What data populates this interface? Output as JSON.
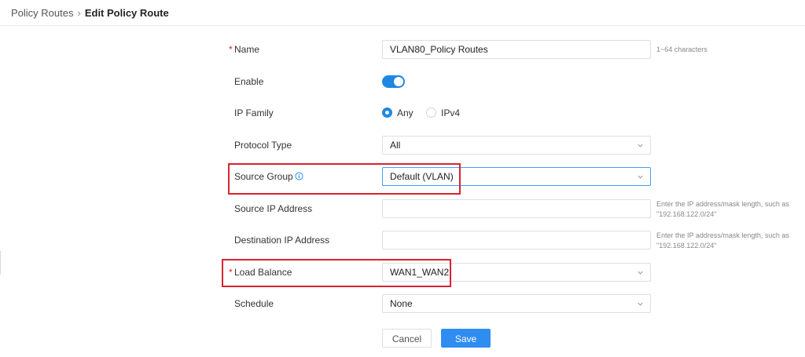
{
  "breadcrumb": {
    "parent": "Policy Routes",
    "separator": "›",
    "current": "Edit Policy Route"
  },
  "form": {
    "name": {
      "label": "Name",
      "required_mark": "*",
      "value": "VLAN80_Policy Routes",
      "hint": "1~64 characters"
    },
    "enable": {
      "label": "Enable",
      "on": true
    },
    "ip_family": {
      "label": "IP Family",
      "options": [
        "Any",
        "IPv4"
      ],
      "selected": "Any"
    },
    "protocol_type": {
      "label": "Protocol Type",
      "value": "All"
    },
    "source_group": {
      "label": "Source Group",
      "value": "Default (VLAN)",
      "icon": "info-icon"
    },
    "source_ip": {
      "label": "Source IP Address",
      "value": "",
      "hint_line1": "Enter the IP address/mask length, such as",
      "hint_line2": "\"192.168.122.0/24\""
    },
    "destination_ip": {
      "label": "Destination IP Address",
      "value": "",
      "hint_line1": "Enter the IP address/mask length, such as",
      "hint_line2": "\"192.168.122.0/24\""
    },
    "load_balance": {
      "label": "Load Balance",
      "required_mark": "*",
      "value": "WAN1_WAN2"
    },
    "schedule": {
      "label": "Schedule",
      "value": "None"
    }
  },
  "buttons": {
    "cancel": "Cancel",
    "save": "Save"
  },
  "colors": {
    "accent": "#1e88e5",
    "highlight": "#d9232e",
    "required": "#e2231a"
  }
}
